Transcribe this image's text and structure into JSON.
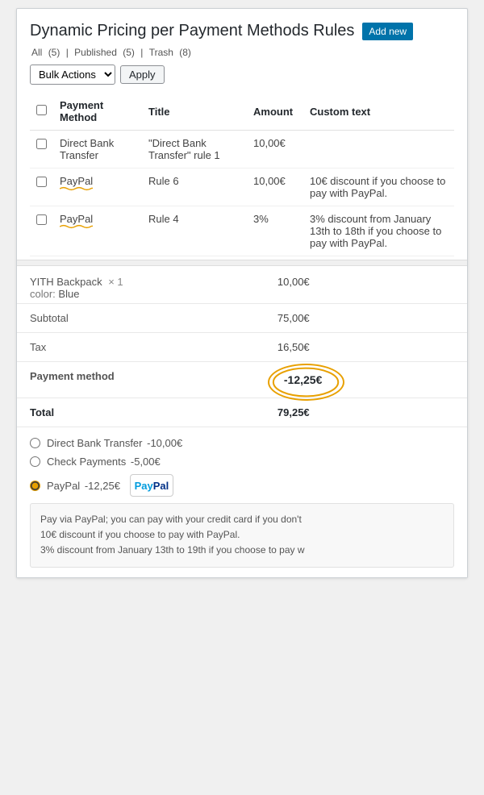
{
  "page": {
    "title": "Dynamic Pricing per Payment Methods Rules",
    "add_new_label": "Add new",
    "filter": {
      "all_label": "All",
      "all_count": "(5)",
      "published_label": "Published",
      "published_count": "(5)",
      "trash_label": "Trash",
      "trash_count": "(8)"
    },
    "bulk_actions_label": "Bulk Actions",
    "apply_label": "Apply"
  },
  "table": {
    "headers": {
      "payment_method": "Payment Method",
      "title": "Title",
      "amount": "Amount",
      "custom_text": "Custom text"
    },
    "rows": [
      {
        "id": 1,
        "payment_method": "Direct Bank Transfer",
        "title": "\"Direct Bank Transfer\" rule 1",
        "amount": "10,00€",
        "custom_text": "",
        "has_squiggle": false
      },
      {
        "id": 2,
        "payment_method": "PayPal",
        "title": "Rule 6",
        "amount": "10,00€",
        "custom_text": "10€ discount if you choose to pay with PayPal.",
        "has_squiggle": true
      },
      {
        "id": 3,
        "payment_method": "PayPal",
        "title": "Rule 4",
        "amount": "3%",
        "custom_text": "3% discount from January 13th to 18th if you choose to pay with PayPal.",
        "has_squiggle": true
      }
    ]
  },
  "order": {
    "product_name": "YITH Backpack",
    "product_qty": "× 1",
    "product_color_label": "color:",
    "product_color": "Blue",
    "product_price": "10,00€",
    "subtotal_label": "Subtotal",
    "subtotal_value": "75,00€",
    "tax_label": "Tax",
    "tax_value": "16,50€",
    "payment_method_label": "Payment method",
    "payment_method_discount": "-12,25€",
    "total_label": "Total",
    "total_value": "79,25€"
  },
  "payment_options": [
    {
      "id": "direct_bank",
      "label": "Direct Bank Transfer",
      "discount": "-10,00€",
      "checked": false,
      "has_logo": false
    },
    {
      "id": "check_payments",
      "label": "Check Payments",
      "discount": "-5,00€",
      "checked": false,
      "has_logo": false
    },
    {
      "id": "paypal",
      "label": "PayPal",
      "discount": "-12,25€",
      "checked": true,
      "has_logo": true,
      "logo_pay": "Pay",
      "logo_pal": "Pal"
    }
  ],
  "paypal_description": {
    "line1": "Pay via PayPal; you can pay with your credit card if you don't",
    "line2": "10€ discount if you choose to pay with PayPal.",
    "line3": "3% discount from January 13th to 19th if you choose to pay w"
  },
  "colors": {
    "squiggle": "#e8a000",
    "circle": "#e8a000",
    "add_new_bg": "#0073aa"
  }
}
